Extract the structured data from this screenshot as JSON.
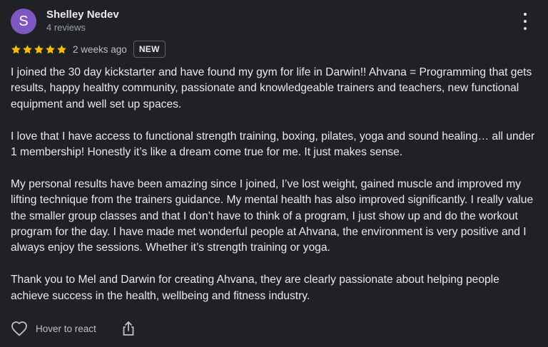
{
  "review": {
    "author": {
      "initial": "S",
      "name": "Shelley Nedev",
      "meta": "4 reviews",
      "avatar_color": "#7e57c2"
    },
    "rating": 5,
    "rating_max": 5,
    "star_color": "#fbbc04",
    "time_ago": "2 weeks ago",
    "badge": "NEW",
    "paragraphs": [
      "I joined the 30 day kickstarter and have found my gym for life in Darwin!! Ahvana = Programming that gets results, happy healthy community, passionate and knowledgeable trainers and teachers, new functional equipment and well set up spaces.",
      "I love that I have access to functional strength training, boxing, pilates, yoga and sound healing… all under 1 membership! Honestly it’s like a dream come true for me. It just makes sense.",
      "My personal results have been amazing since I joined, I’ve lost weight, gained muscle and improved my lifting technique from the trainers guidance. My mental health has also improved significantly. I really value the smaller group classes and that I don’t have to think of a program, I just show up and do the workout program for the day. I have made met wonderful people at Ahvana, the environment is very positive and I always enjoy the sessions. Whether it’s strength training or yoga.",
      "Thank you to Mel and Darwin for creating Ahvana, they are clearly passionate about helping people achieve success in the health, wellbeing and fitness industry."
    ]
  },
  "actions": {
    "react_label": "Hover to react",
    "react_icon": "heart-outline-icon",
    "share_icon": "share-icon",
    "more_icon": "more-vert-icon"
  }
}
